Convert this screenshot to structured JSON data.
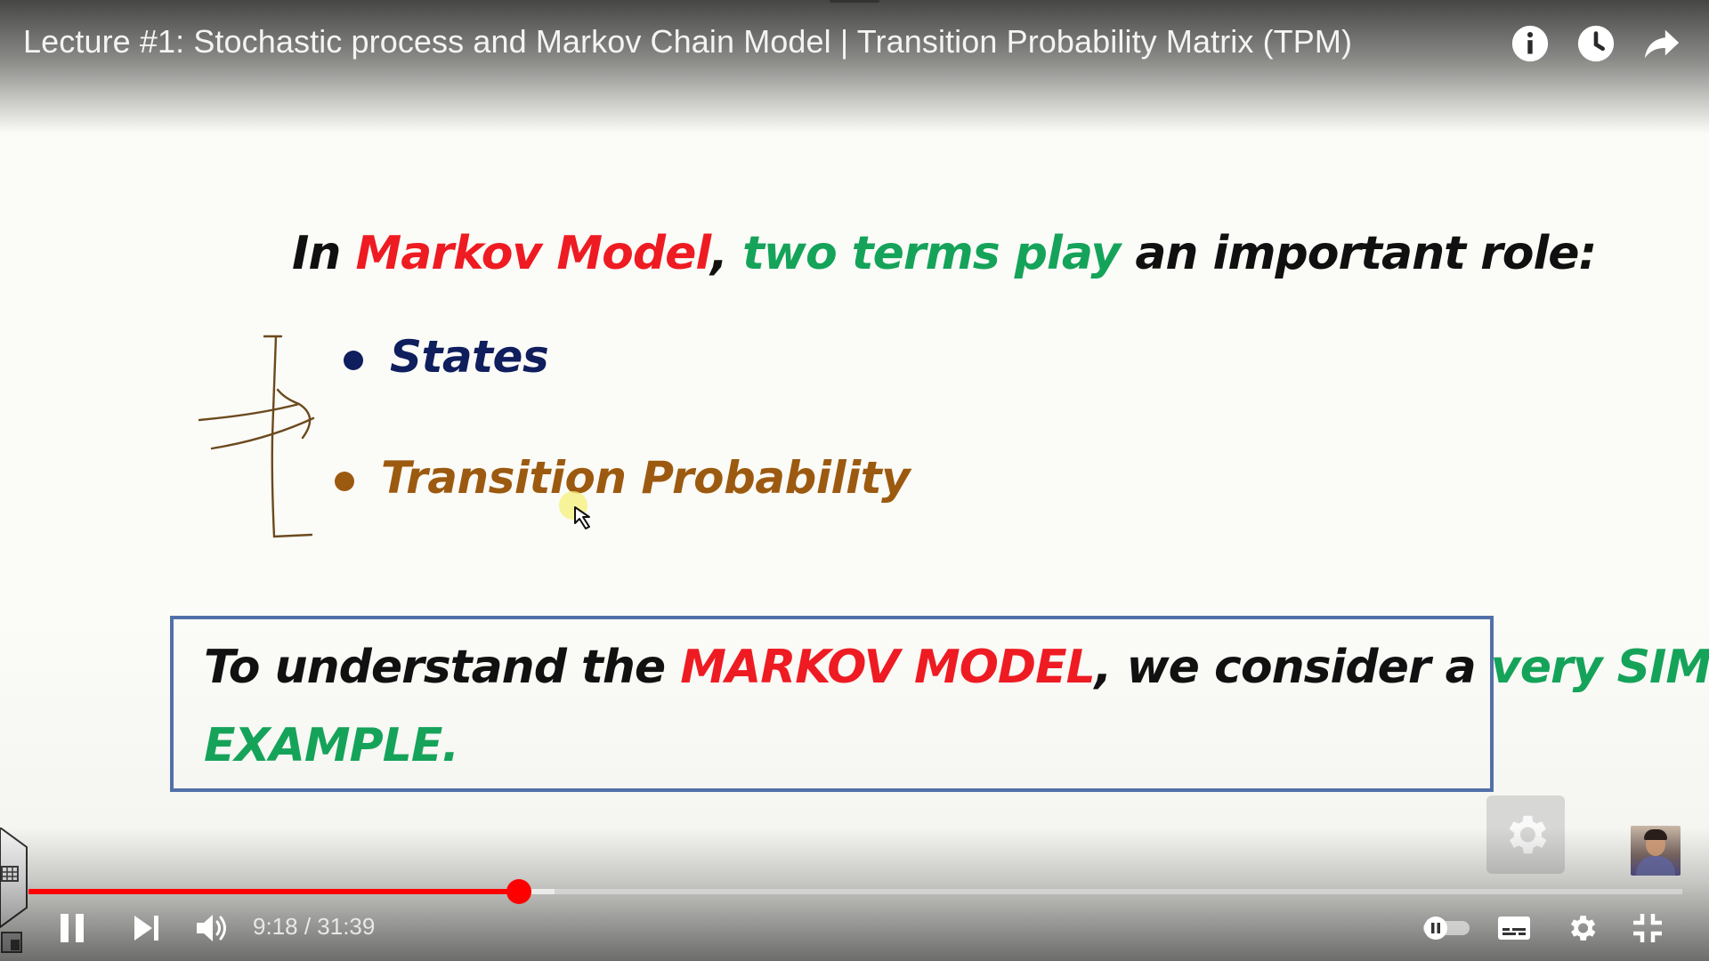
{
  "player": {
    "title": "Lecture #1: Stochastic process and Markov Chain Model | Transition Probability Matrix (TPM)",
    "time": {
      "current": "9:18",
      "separator": " / ",
      "duration": "31:39"
    },
    "progress": {
      "played_fraction": 0.2963,
      "buffered_fraction": 0.2651
    },
    "top_buttons": [
      "info-icon",
      "watch-later-icon",
      "share-icon"
    ],
    "bottom_buttons": [
      "pause-icon",
      "next-icon",
      "volume-icon",
      "autoplay-toggle",
      "captions-icon",
      "settings-icon",
      "exit-fullscreen-icon"
    ],
    "colors": {
      "accent": "#ff0000"
    }
  },
  "slide": {
    "heading": {
      "part1": "In ",
      "part2": "Markov Model",
      "part3": ", ",
      "part4": "two terms play",
      "part5": " an important role:"
    },
    "bullets": [
      "States",
      "Transition Probability"
    ],
    "note": {
      "part1": "To understand the ",
      "part2": "MARKOV MODEL",
      "part3": ", we consider a ",
      "part4": "very SIMPLE",
      "part5": "EXAMPLE."
    },
    "colors": {
      "red": "#ee1b22",
      "green": "#15a35a",
      "navy": "#0f1e5d",
      "brown": "#9c5a10",
      "box_border": "#5270a8"
    }
  }
}
